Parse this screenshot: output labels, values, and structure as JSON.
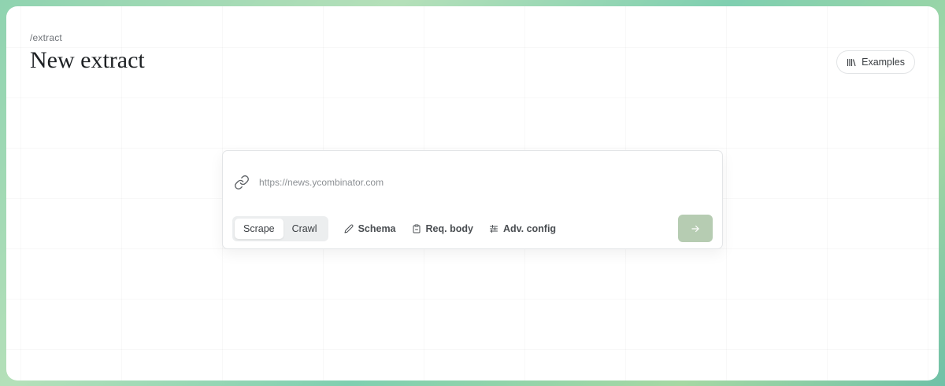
{
  "header": {
    "breadcrumb": "/extract",
    "title": "New extract",
    "examples_label": "Examples"
  },
  "form": {
    "url_placeholder": "https://news.ycombinator.com",
    "url_value": "",
    "modes": [
      {
        "label": "Scrape",
        "active": true
      },
      {
        "label": "Crawl",
        "active": false
      }
    ],
    "tools": [
      {
        "label": "Schema",
        "icon": "pencil-icon"
      },
      {
        "label": "Req. body",
        "icon": "clipboard-icon"
      },
      {
        "label": "Adv. config",
        "icon": "sliders-icon"
      }
    ],
    "submit_icon": "arrow-right-icon"
  },
  "colors": {
    "submit_bg": "#b6ccb2",
    "frame_gradient": "#8fd3b0"
  }
}
